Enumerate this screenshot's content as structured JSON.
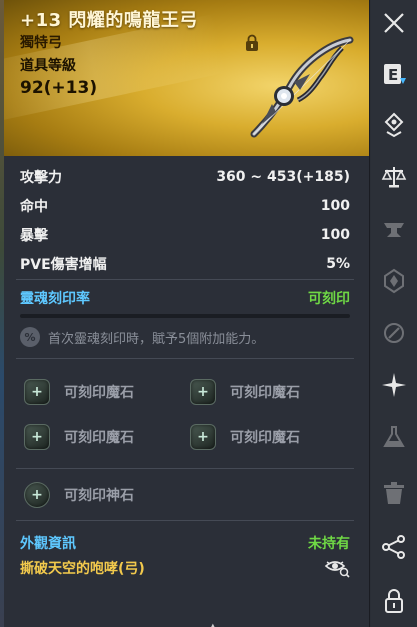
{
  "item": {
    "name": "+13 閃耀的鳴龍王弓",
    "rarity": "獨特弓",
    "equip_level_label": "道具等級",
    "equip_level_value": "92(+13)"
  },
  "stats": [
    {
      "label": "攻擊力",
      "value": "360 ~ 453(+185)"
    },
    {
      "label": "命中",
      "value": "100"
    },
    {
      "label": "暴擊",
      "value": "100"
    },
    {
      "label": "PVE傷害增幅",
      "value": "5%"
    }
  ],
  "soul": {
    "label": "靈魂刻印率",
    "status": "可刻印",
    "info_icon": "%",
    "info": "首次靈魂刻印時，賦予5個附加能力。"
  },
  "magic_stones": [
    {
      "label": "可刻印魔石"
    },
    {
      "label": "可刻印魔石"
    },
    {
      "label": "可刻印魔石"
    },
    {
      "label": "可刻印魔石"
    }
  ],
  "god_stone": {
    "label": "可刻印神石"
  },
  "appearance": {
    "label": "外觀資訊",
    "status": "未持有",
    "name": "撕破天空的咆哮(弓)"
  },
  "toolbar": {
    "close_glyph": "✕",
    "e_glyph": "E"
  },
  "colors": {
    "header_gold": "#d9ad2e",
    "soul_blue": "#5ec8ff",
    "status_green": "#6fd845",
    "appearance_gold": "#f2c94c"
  }
}
